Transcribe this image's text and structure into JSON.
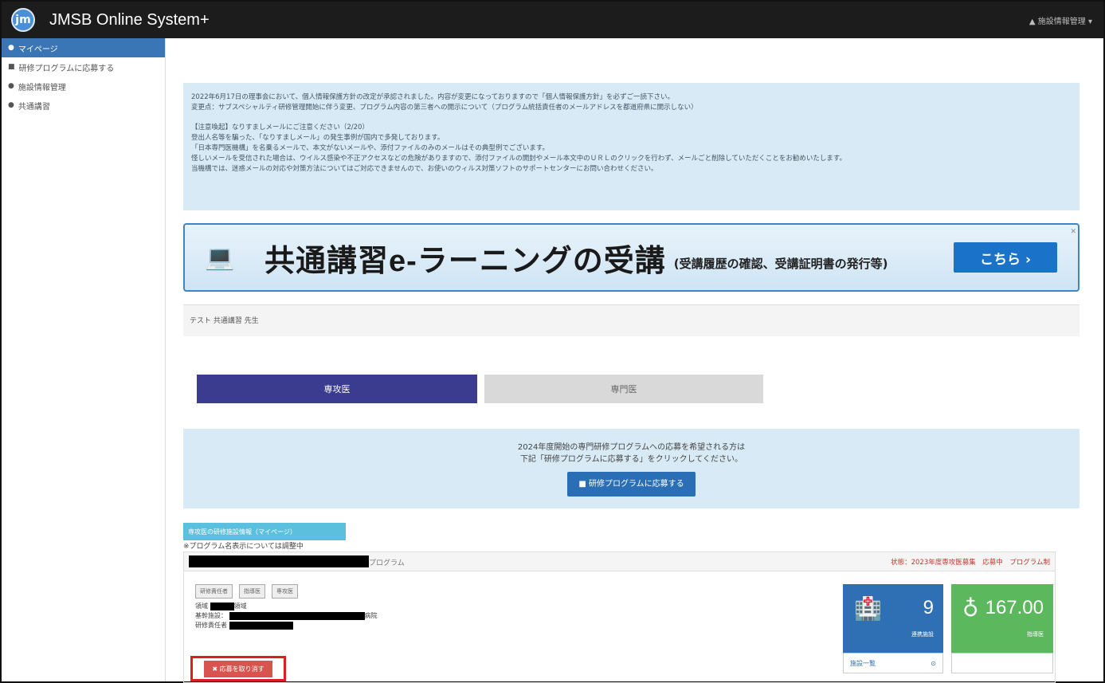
{
  "header": {
    "app_title": "JMSB Online System+",
    "user_menu": "▲ 施設情報管理 ▾",
    "logo_text": "jm"
  },
  "sidebar": {
    "items": [
      {
        "label": "マイページ",
        "icon": "home-icon"
      },
      {
        "label": "研修プログラムに応募する",
        "icon": "book-icon"
      },
      {
        "label": "施設情報管理",
        "icon": "building-icon"
      },
      {
        "label": "共通講習",
        "icon": "school-icon"
      }
    ]
  },
  "notice": {
    "line1": "2022年6月17日の理事会において、個人情報保護方針の改定が承認されました。内容が変更になっておりますので「個人情報保護方針」を必ずご一読下さい。",
    "line2": "変更点：サブスペシャルティ研修管理開始に伴う変更、プログラム内容の第三者への開示について（プログラム統括責任者のメールアドレスを都道府県に開示しない）",
    "line3": "【注意喚起】なりすましメールにご注意ください（2/20）",
    "line4": "登出人名等を騙った、「なりすましメール」の発生事例が国内で多発しております。",
    "line5": "「日本専門医機構」を名乗るメールで、本文がないメールや、添付ファイルのみのメールはその典型例でございます。",
    "line6": "怪しいメールを受信された場合は、ウイルス感染や不正アクセスなどの危険がありますので、添付ファイルの開封やメール本文中のＵＲＬのクリックを行わず、メールごと削除していただくことをお勧めいたします。",
    "line7": "当機構では、迷惑メールの対応や対策方法についてはご対応できませんので、お使いのウィルス対策ソフトのサポートセンターにお問い合わせください。"
  },
  "banner": {
    "title": "共通講習e-ラーニングの受講",
    "subtitle": "(受講履歴の確認、受講証明書の発行等)",
    "button": "こちら ›",
    "close": "✕"
  },
  "user_name": "テスト 共通講習 先生",
  "tabs": [
    {
      "label": "専攻医",
      "active": true
    },
    {
      "label": "専門医",
      "active": false
    }
  ],
  "apply": {
    "line1": "2024年度開始の専門研修プログラムへの応募を希望される方は",
    "line2": "下記「研修プログラムに応募する」をクリックしてください。",
    "button": "研修プログラムに応募する"
  },
  "info_tab": "専攻医の研修施設情報（マイページ）",
  "program_note": "※プログラム名表示については調整中",
  "program": {
    "name_suffix": "プログラム",
    "status": "状態：2023年度専攻医募集　応募中　プログラム制",
    "badges": [
      "研修責任者",
      "指導医",
      "専攻医"
    ],
    "field_label": "領域",
    "field_suffix": "領域",
    "facility_label": "基幹施設：",
    "facility_suffix": "病院",
    "manager_label": "研修責任者",
    "cancel_button": "✖ 応募を取り消す"
  },
  "stats": {
    "facilities_value": "9",
    "facilities_label": "連携施設",
    "facilities_link": "施設一覧",
    "instructors_value": "167.00",
    "instructors_label": "指導医"
  }
}
